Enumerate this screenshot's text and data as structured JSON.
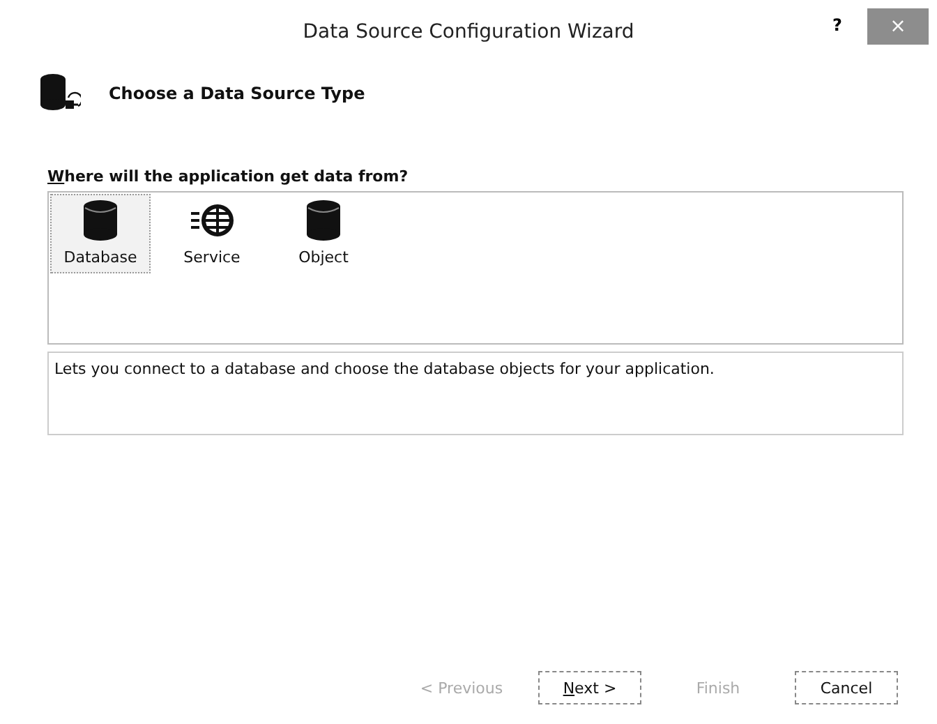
{
  "window": {
    "title": "Data Source Configuration Wizard",
    "help": "?",
    "close": "×"
  },
  "header": {
    "title": "Choose a Data Source Type"
  },
  "question": {
    "label": "Where will the application get data from?",
    "underline_first": true
  },
  "sources": [
    {
      "label": "Database",
      "kind": "database",
      "selected": true
    },
    {
      "label": "Service",
      "kind": "service",
      "selected": false
    },
    {
      "label": "Object",
      "kind": "object",
      "selected": false
    }
  ],
  "description": "Lets you connect to a database and choose the database objects for your application.",
  "buttons": [
    {
      "label": "< Previous",
      "disabled": true,
      "underline_first": false
    },
    {
      "label": "Next >",
      "disabled": false,
      "underline_first": true
    },
    {
      "label": "Finish",
      "disabled": true,
      "underline_first": false
    },
    {
      "label": "Cancel",
      "disabled": false,
      "underline_first": false
    }
  ]
}
